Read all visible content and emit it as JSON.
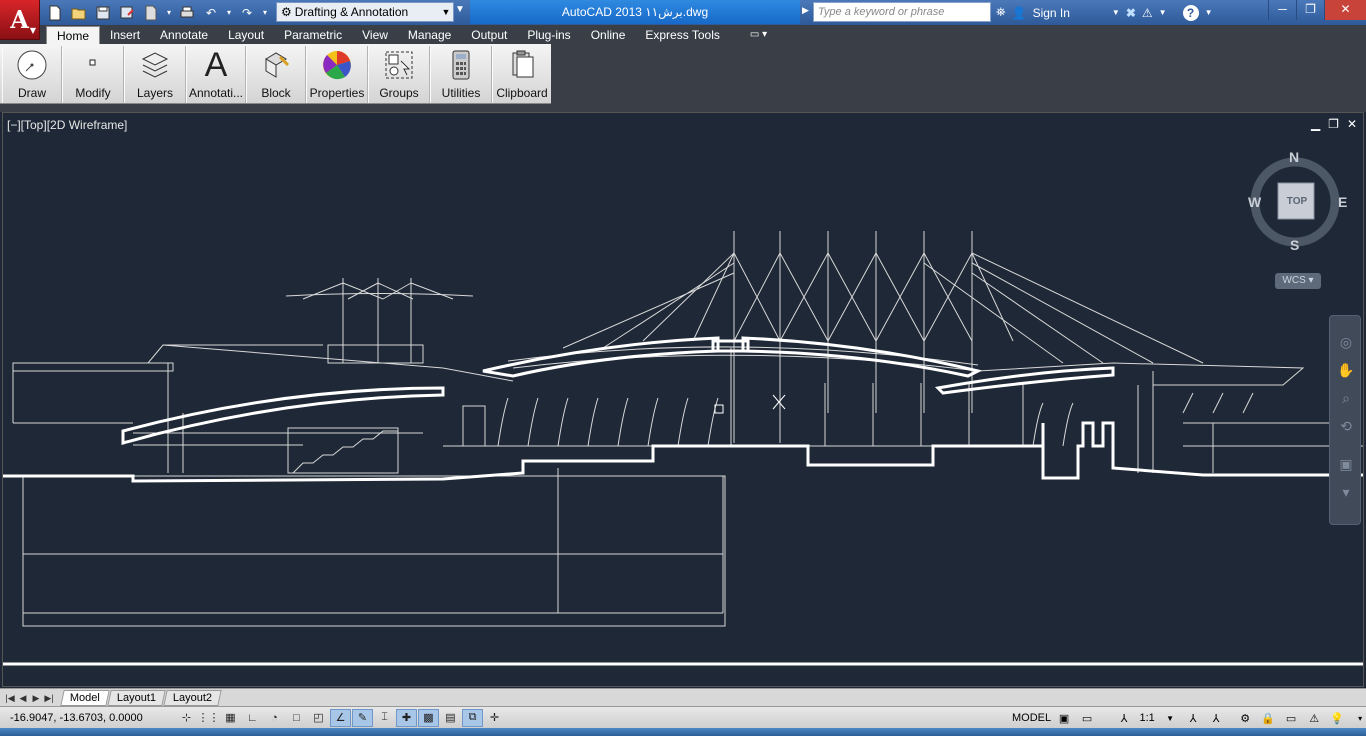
{
  "titlebar": {
    "logo_letter": "A",
    "workspace": "Drafting & Annotation",
    "document_title": "AutoCAD 2013     برش١١.dwg",
    "search_placeholder": "Type a keyword or phrase",
    "sign_in": "Sign In",
    "help": "?",
    "qat_icons": [
      "new-icon",
      "open-icon",
      "save-icon",
      "save-as-icon",
      "publish-icon",
      "plot-icon",
      "undo-icon",
      "redo-icon"
    ]
  },
  "ribbon_tabs": [
    "Home",
    "Insert",
    "Annotate",
    "Layout",
    "Parametric",
    "View",
    "Manage",
    "Output",
    "Plug-ins",
    "Online",
    "Express Tools"
  ],
  "active_tab": "Home",
  "ribbon_panels": [
    {
      "label": "Draw",
      "icon": "draw-icon"
    },
    {
      "label": "Modify",
      "icon": "modify-icon"
    },
    {
      "label": "Layers",
      "icon": "layers-icon"
    },
    {
      "label": "Annotati...",
      "icon": "annotation-icon"
    },
    {
      "label": "Block",
      "icon": "block-icon"
    },
    {
      "label": "Properties",
      "icon": "properties-icon"
    },
    {
      "label": "Groups",
      "icon": "groups-icon"
    },
    {
      "label": "Utilities",
      "icon": "utilities-icon"
    },
    {
      "label": "Clipboard",
      "icon": "clipboard-icon"
    }
  ],
  "viewport": {
    "label": "[−][Top][2D Wireframe]",
    "viewcube": {
      "north": "N",
      "south": "S",
      "east": "E",
      "west": "W",
      "face": "TOP"
    },
    "ucs_label": "WCS"
  },
  "layout_tabs": [
    "Model",
    "Layout1",
    "Layout2"
  ],
  "active_layout": "Model",
  "statusbar": {
    "coordinates": "-16.9047, -13.6703, 0.0000",
    "space": "MODEL",
    "annotation_scale": "1:1"
  }
}
